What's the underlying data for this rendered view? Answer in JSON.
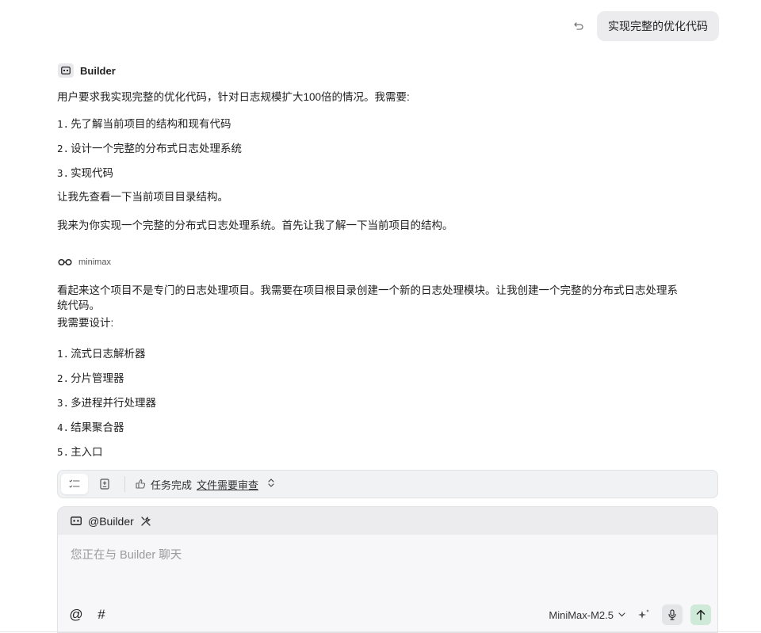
{
  "user_message": {
    "text": "实现完整的优化代码"
  },
  "builder_block": {
    "name": "Builder",
    "intro": "用户要求我实现完整的优化代码，针对日志规模扩大100倍的情况。我需要:",
    "steps": [
      {
        "num": "1.",
        "text": "先了解当前项目的结构和现有代码"
      },
      {
        "num": "2.",
        "text": "设计一个完整的分布式日志处理系统"
      },
      {
        "num": "3.",
        "text": "实现代码"
      }
    ],
    "para1": "让我先查看一下当前项目目录结构。",
    "para2": "我来为你实现一个完整的分布式日志处理系统。首先让我了解一下当前项目的结构。"
  },
  "minimax_block": {
    "name": "minimax",
    "para_line1": "看起来这个项目不是专门的日志处理项目。我需要在项目根目录创建一个新的日志处理模块。让我创建一个完整的分布式日志处理系",
    "para_line2": "统代码。",
    "para_line3": "我需要设计:",
    "steps": [
      {
        "num": "1.",
        "text": "流式日志解析器"
      },
      {
        "num": "2.",
        "text": "分片管理器"
      },
      {
        "num": "3.",
        "text": "多进程并行处理器"
      },
      {
        "num": "4.",
        "text": "结果聚合器"
      },
      {
        "num": "5.",
        "text": "主入口"
      }
    ]
  },
  "task_bar": {
    "status_text": "任务完成",
    "link_text": "文件需要审查"
  },
  "composer": {
    "agent_label": "@Builder",
    "placeholder": "您正在与 Builder 聊天",
    "at_symbol": "@",
    "hash_symbol": "#",
    "model": "MiniMax-M2.5"
  },
  "colors": {
    "send_button_bg": "#cfead9",
    "user_bubble_bg": "#ececef"
  }
}
